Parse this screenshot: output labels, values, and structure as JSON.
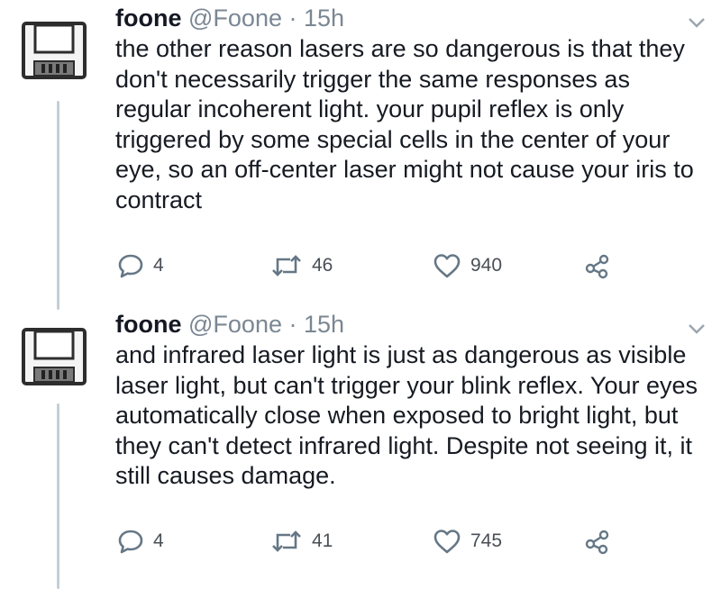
{
  "tweets": [
    {
      "display_name": "foone",
      "handle": "@Foone",
      "separator": "·",
      "time": "15h",
      "text": "the other reason lasers are so dangerous is that they don't necessarily trigger the same responses as regular incoherent light. your pupil reflex is only triggered by some special cells in the center of your eye, so an off-center laser might not cause your iris to contract",
      "replies": "4",
      "retweets": "46",
      "likes": "940"
    },
    {
      "display_name": "foone",
      "handle": "@Foone",
      "separator": "·",
      "time": "15h",
      "text": "and infrared laser light is just as dangerous as visible laser light, but can't trigger your blink reflex. Your eyes automatically close when exposed to bright light, but they can't detect infrared light. Despite not seeing it, it still causes damage.",
      "replies": "4",
      "retweets": "41",
      "likes": "745"
    }
  ],
  "icons": {
    "avatar": "floppy-disk-icon",
    "menu": "chevron-down-icon",
    "reply": "reply-icon",
    "retweet": "retweet-icon",
    "like": "heart-icon",
    "share": "share-icon"
  },
  "colors": {
    "text": "#141823",
    "meta": "#7a8793",
    "icon": "#657786",
    "thread_line": "#c4cfd6"
  }
}
